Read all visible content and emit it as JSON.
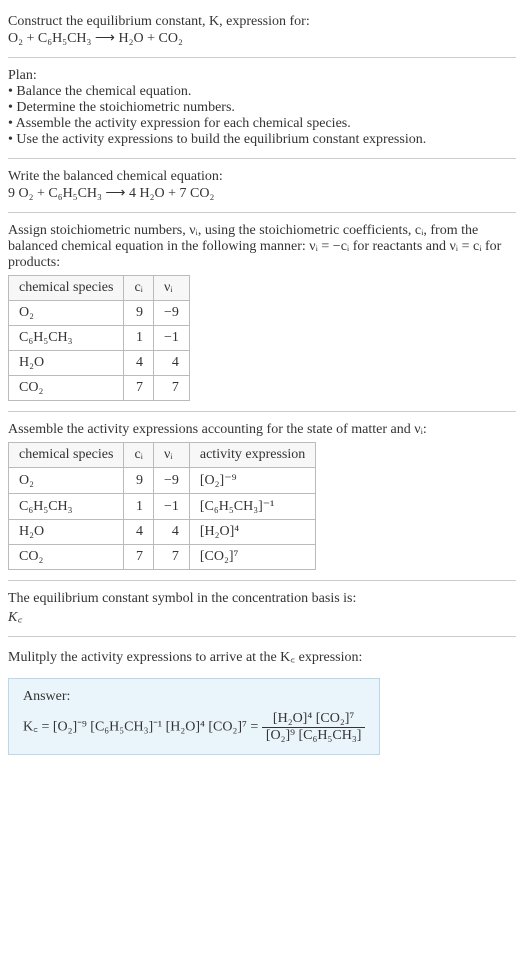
{
  "top": {
    "prompt_line1": "Construct the equilibrium constant, K, expression for:",
    "eq_unbalanced": "O₂ + C₆H₅CH₃ ⟶ H₂O + CO₂"
  },
  "plan": {
    "heading": "Plan:",
    "b1": "• Balance the chemical equation.",
    "b2": "• Determine the stoichiometric numbers.",
    "b3": "• Assemble the activity expression for each chemical species.",
    "b4": "• Use the activity expressions to build the equilibrium constant expression."
  },
  "balanced": {
    "heading": "Write the balanced chemical equation:",
    "eq": "9 O₂ + C₆H₅CH₃ ⟶ 4 H₂O + 7 CO₂"
  },
  "stoich": {
    "text": "Assign stoichiometric numbers, νᵢ, using the stoichiometric coefficients, cᵢ, from the balanced chemical equation in the following manner: νᵢ = −cᵢ for reactants and νᵢ = cᵢ for products:",
    "th1": "chemical species",
    "th2": "cᵢ",
    "th3": "νᵢ",
    "rows": [
      {
        "sp": "O₂",
        "c": "9",
        "v": "−9"
      },
      {
        "sp": "C₆H₅CH₃",
        "c": "1",
        "v": "−1"
      },
      {
        "sp": "H₂O",
        "c": "4",
        "v": "4"
      },
      {
        "sp": "CO₂",
        "c": "7",
        "v": "7"
      }
    ]
  },
  "activity": {
    "text": "Assemble the activity expressions accounting for the state of matter and νᵢ:",
    "th1": "chemical species",
    "th2": "cᵢ",
    "th3": "νᵢ",
    "th4": "activity expression",
    "rows": [
      {
        "sp": "O₂",
        "c": "9",
        "v": "−9",
        "a": "[O₂]⁻⁹"
      },
      {
        "sp": "C₆H₅CH₃",
        "c": "1",
        "v": "−1",
        "a": "[C₆H₅CH₃]⁻¹"
      },
      {
        "sp": "H₂O",
        "c": "4",
        "v": "4",
        "a": "[H₂O]⁴"
      },
      {
        "sp": "CO₂",
        "c": "7",
        "v": "7",
        "a": "[CO₂]⁷"
      }
    ]
  },
  "symbol": {
    "text": "The equilibrium constant symbol in the concentration basis is:",
    "sym": "K꜀"
  },
  "multiply": {
    "text": "Mulitply the activity expressions to arrive at the K꜀ expression:"
  },
  "answer": {
    "label": "Answer:",
    "lhs": "K꜀ = [O₂]⁻⁹ [C₆H₅CH₃]⁻¹ [H₂O]⁴ [CO₂]⁷ = ",
    "frac_num": "[H₂O]⁴ [CO₂]⁷",
    "frac_den": "[O₂]⁹ [C₆H₅CH₃]"
  },
  "chart_data": {
    "type": "table",
    "tables": [
      {
        "title": "Stoichiometric numbers",
        "columns": [
          "chemical species",
          "cᵢ",
          "νᵢ"
        ],
        "rows": [
          [
            "O₂",
            9,
            -9
          ],
          [
            "C₆H₅CH₃",
            1,
            -1
          ],
          [
            "H₂O",
            4,
            4
          ],
          [
            "CO₂",
            7,
            7
          ]
        ]
      },
      {
        "title": "Activity expressions",
        "columns": [
          "chemical species",
          "cᵢ",
          "νᵢ",
          "activity expression"
        ],
        "rows": [
          [
            "O₂",
            9,
            -9,
            "[O₂]⁻⁹"
          ],
          [
            "C₆H₅CH₃",
            1,
            -1,
            "[C₆H₅CH₃]⁻¹"
          ],
          [
            "H₂O",
            4,
            4,
            "[H₂O]⁴"
          ],
          [
            "CO₂",
            7,
            7,
            "[CO₂]⁷"
          ]
        ]
      }
    ]
  }
}
